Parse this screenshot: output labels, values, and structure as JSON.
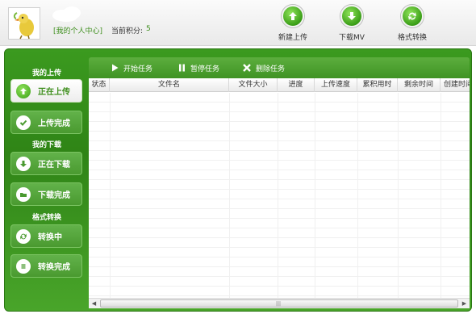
{
  "header": {
    "user_center_link": "[我的个人中心]",
    "points_label": "当前积分:",
    "points_value": "5",
    "buttons": [
      {
        "label": "新建上传",
        "icon": "upload-icon"
      },
      {
        "label": "下载MV",
        "icon": "download-icon"
      },
      {
        "label": "格式转换",
        "icon": "convert-icon"
      }
    ]
  },
  "sidebar": {
    "upload_section": "我的上传",
    "download_section": "我的下载",
    "convert_section": "格式转换",
    "items": [
      {
        "label": "正在上传",
        "icon": "upload-icon",
        "active": true
      },
      {
        "label": "上传完成",
        "icon": "check-icon",
        "active": false
      },
      {
        "label": "正在下载",
        "icon": "download-icon",
        "active": false
      },
      {
        "label": "下载完成",
        "icon": "folder-icon",
        "active": false
      },
      {
        "label": "转换中",
        "icon": "convert-icon",
        "active": false
      },
      {
        "label": "转换完成",
        "icon": "list-icon",
        "active": false
      }
    ]
  },
  "toolbar": {
    "start_label": "开始任务",
    "pause_label": "暂停任务",
    "delete_label": "删除任务"
  },
  "table": {
    "columns": [
      "状态",
      "文件名",
      "文件大小",
      "进度",
      "上传速度",
      "累积用时",
      "剩余时间",
      "创建时间"
    ],
    "rows": []
  },
  "colors": {
    "brand_green": "#3a9e17",
    "link_green": "#3f8f1e",
    "frame_green": "#2f8416"
  }
}
